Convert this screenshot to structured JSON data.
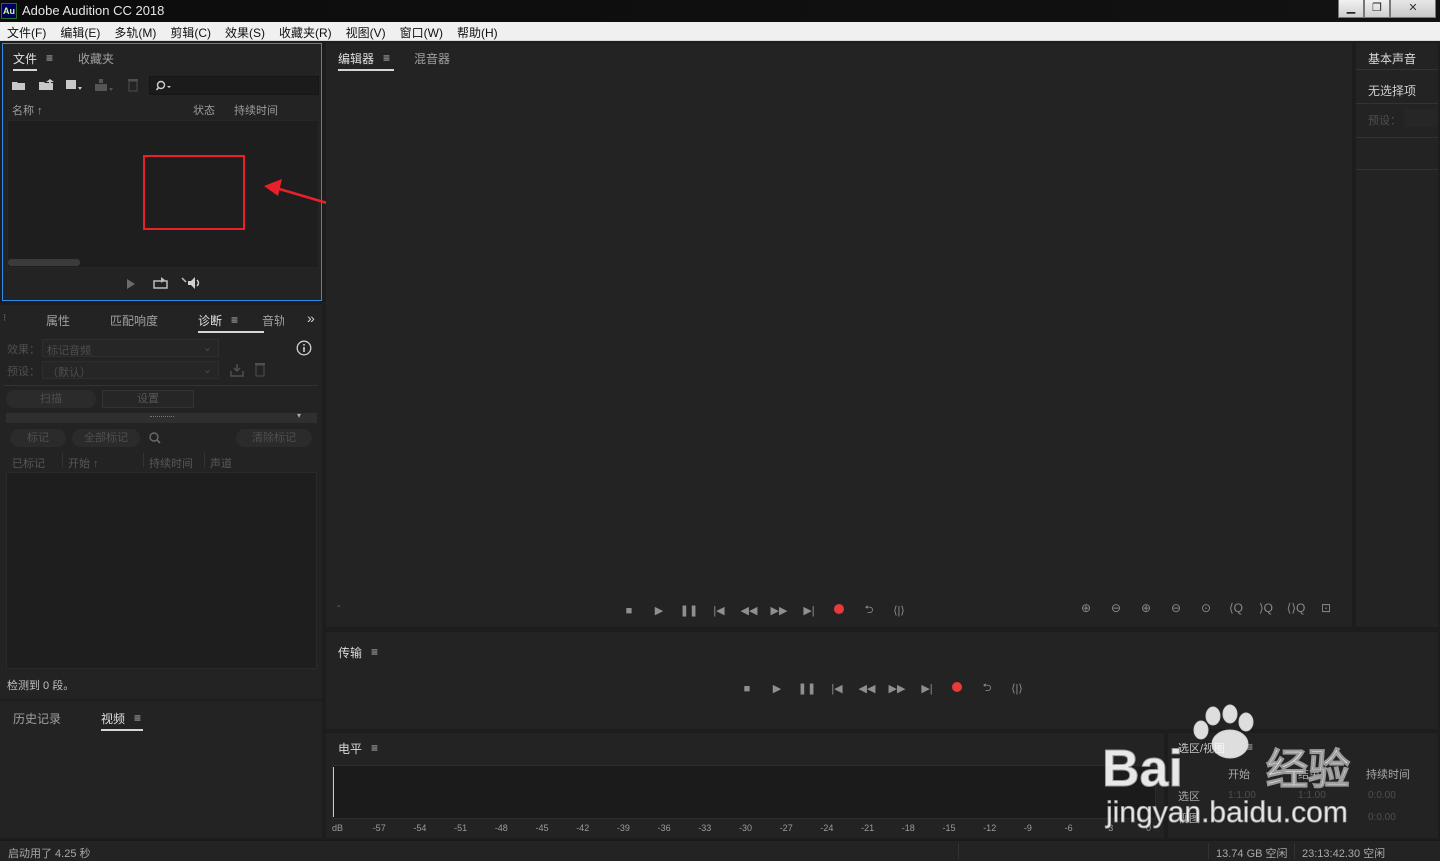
{
  "window": {
    "icon_text": "Au",
    "title": "Adobe Audition CC 2018",
    "buttons": {
      "minimize": "▁",
      "maximize": "❐",
      "close": "✕"
    }
  },
  "menubar": [
    "文件(F)",
    "编辑(E)",
    "多轨(M)",
    "剪辑(C)",
    "效果(S)",
    "收藏夹(R)",
    "视图(V)",
    "窗口(W)",
    "帮助(H)"
  ],
  "files_panel": {
    "tabs": [
      "文件",
      "收藏夹"
    ],
    "active_tab": "文件",
    "columns": {
      "name": "名称",
      "status": "状态",
      "duration": "持续时间"
    },
    "search_placeholder": ""
  },
  "diagnostics_panel": {
    "tabs": [
      "属性",
      "匹配响度",
      "诊断",
      "音轨"
    ],
    "active_tab": "诊断",
    "effect_label": "效果：",
    "effect_value": "标记音频",
    "preset_label": "预设：",
    "preset_value": "（默认）",
    "scan_button": "扫描",
    "settings_button": "设置",
    "mark_button": "标记",
    "mark_all_button": "全部标记",
    "clear_marks_button": "清除标记",
    "columns": {
      "marked": "已标记",
      "start": "开始",
      "duration": "持续时间",
      "channel": "声道"
    },
    "status": "检测到 0 段。"
  },
  "history_panel": {
    "tabs": [
      "历史记录",
      "视频"
    ],
    "active_tab": "视频"
  },
  "editor_panel": {
    "tabs": [
      "编辑器",
      "混音器"
    ],
    "active_tab": "编辑器",
    "left_marker": "-"
  },
  "essential_sound": {
    "title": "基本声音",
    "no_selection": "无选择项",
    "preset_label": "预设："
  },
  "transport_panel": {
    "title": "传输"
  },
  "levels_panel": {
    "title": "电平",
    "scale": [
      "dB",
      "-57",
      "-54",
      "-51",
      "-48",
      "-45",
      "-42",
      "-39",
      "-36",
      "-33",
      "-30",
      "-27",
      "-24",
      "-21",
      "-18",
      "-15",
      "-12",
      "-9",
      "-6",
      "-3",
      "0"
    ]
  },
  "selection_view": {
    "title": "选区/视图",
    "columns": [
      "开始",
      "结束",
      "持续时间"
    ],
    "rows": [
      {
        "label": "选区",
        "start": "1:1.00",
        "end": "1:1.00",
        "duration": "0:0.00"
      },
      {
        "label": "视图",
        "start": "",
        "end": "",
        "duration": "0:0.00"
      }
    ]
  },
  "statusbar": {
    "startup": "启动用了 4.25 秒",
    "free_space": "13.74 GB 空闲",
    "free_time": "23:13:42.30 空闲"
  },
  "watermark": {
    "brand": "Bai",
    "brand2": "经验",
    "url": "jingyan.baidu.com"
  },
  "colors": {
    "selection_border": "#2d8ceb",
    "highlight": "#e8202a",
    "record": "#e83a3a",
    "meter": "#e6d84a"
  }
}
